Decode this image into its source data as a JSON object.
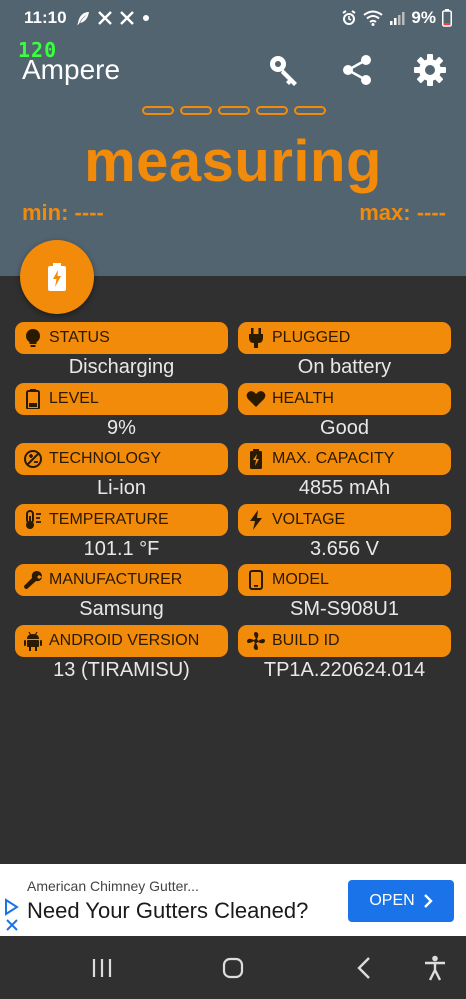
{
  "status_bar": {
    "time": "11:10",
    "battery_percent": "9%"
  },
  "overlay": {
    "fps": "120"
  },
  "app": {
    "title": "Ampere",
    "measuring_text": "measuring",
    "min_label": "min: ----",
    "max_label": "max: ----",
    "accent_color": "#f28a0a"
  },
  "toolbar": {
    "icons": [
      "key-icon",
      "share-icon",
      "settings-icon"
    ]
  },
  "info": [
    {
      "label": "STATUS",
      "value": "Discharging",
      "icon": "bulb-icon"
    },
    {
      "label": "PLUGGED",
      "value": "On battery",
      "icon": "plug-icon"
    },
    {
      "label": "LEVEL",
      "value": "9%",
      "icon": "battery-icon"
    },
    {
      "label": "HEALTH",
      "value": "Good",
      "icon": "heart-icon"
    },
    {
      "label": "TECHNOLOGY",
      "value": "Li-ion",
      "icon": "tech-icon"
    },
    {
      "label": "MAX. CAPACITY",
      "value": "4855 mAh",
      "icon": "battery-charging-icon"
    },
    {
      "label": "TEMPERATURE",
      "value": "101.1 °F",
      "icon": "thermometer-icon"
    },
    {
      "label": "VOLTAGE",
      "value": "3.656 V",
      "icon": "bolt-icon"
    },
    {
      "label": "MANUFACTURER",
      "value": "Samsung",
      "icon": "wrench-icon"
    },
    {
      "label": "MODEL",
      "value": "SM-S908U1",
      "icon": "phone-icon"
    },
    {
      "label": "ANDROID VERSION",
      "value": "13 (TIRAMISU)",
      "icon": "android-icon"
    },
    {
      "label": "BUILD ID",
      "value": "TP1A.220624.014",
      "icon": "fan-icon"
    }
  ],
  "ad": {
    "advertiser": "American Chimney Gutter...",
    "headline": "Need Your Gutters Cleaned?",
    "cta": "OPEN"
  }
}
